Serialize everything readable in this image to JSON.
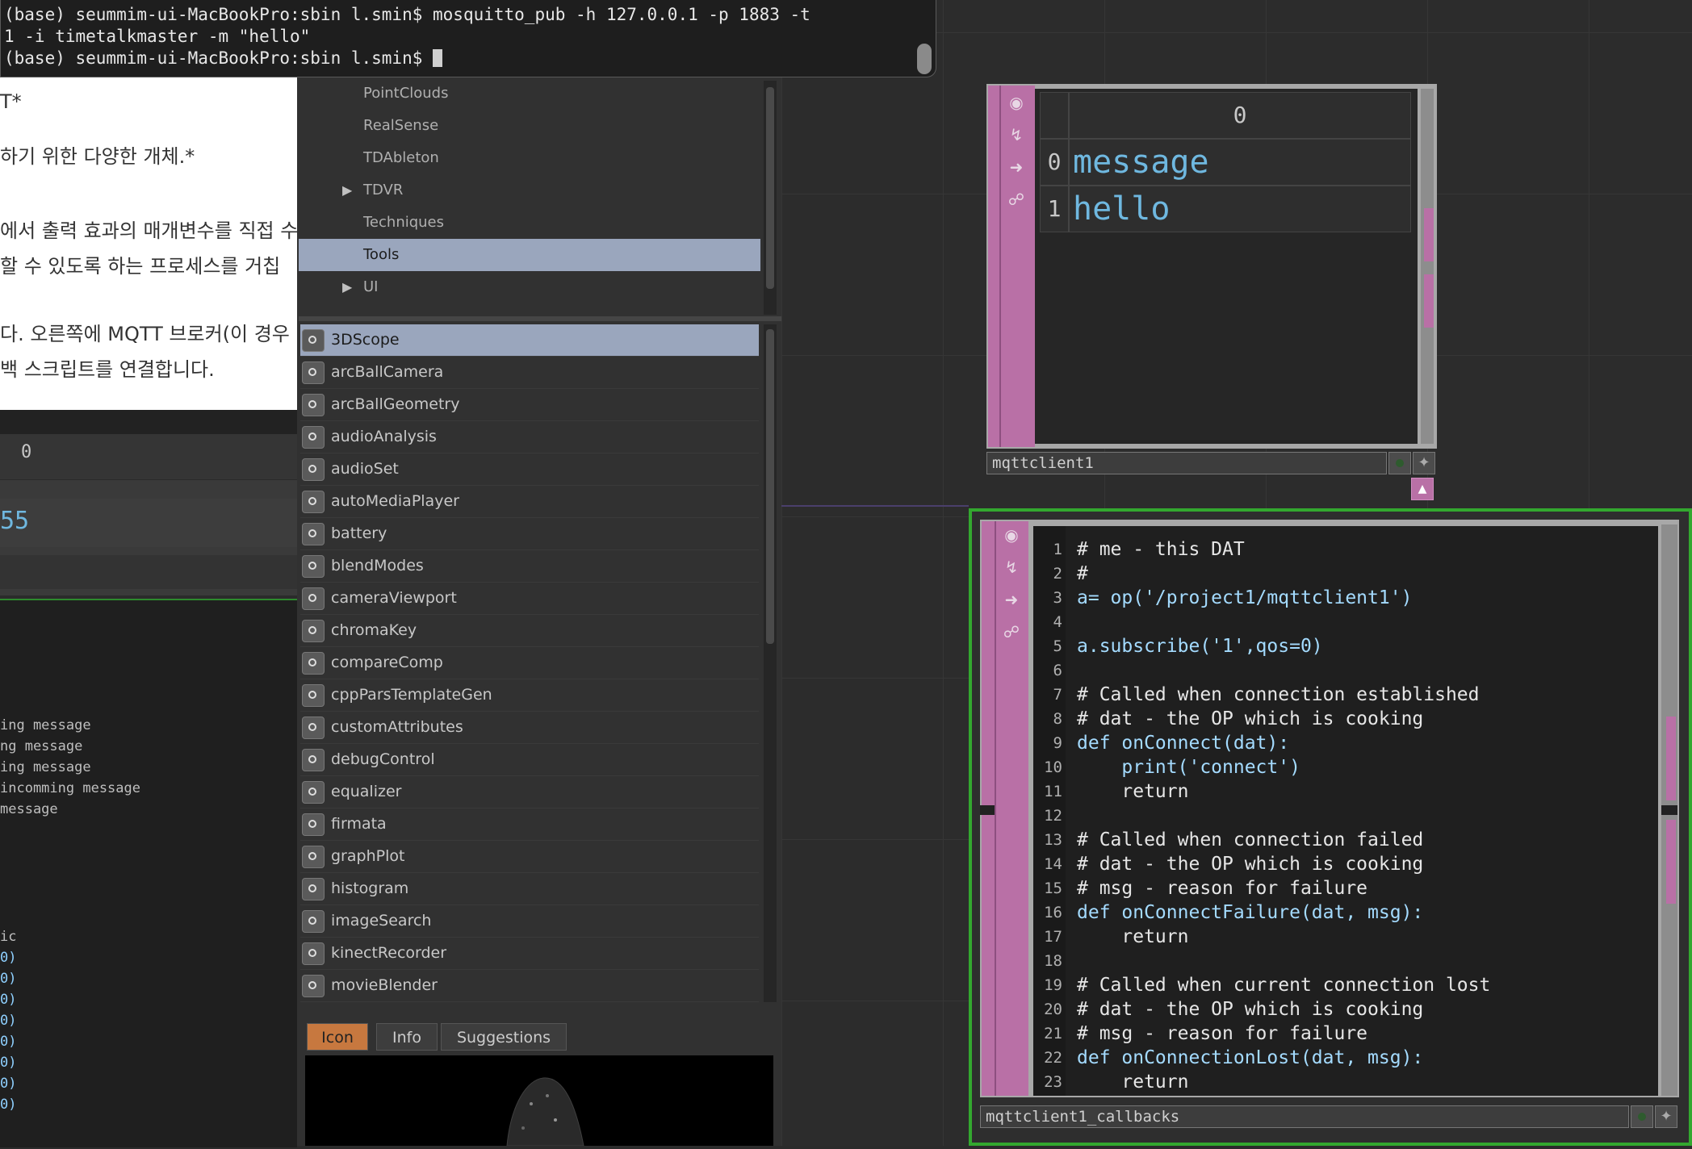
{
  "terminal": {
    "line1": "(base) seummim-ui-MacBookPro:sbin l.smin$ mosquitto_pub -h 127.0.0.1 -p 1883 -t ",
    "line2": "1 -i timetalkmaster -m \"hello\"",
    "line3": "(base) seummim-ui-MacBookPro:sbin l.smin$ "
  },
  "doc": {
    "lines": [
      "T*",
      "하기 위한 다양한 개체.*",
      "에서 출력 효과의 매개변수를 직접 수",
      "할 수 있도록 하는 프로세스를 거칩",
      "다. 오른쪽에 MQTT 브로커(이 경우",
      "백 스크립트를 연결합니다."
    ]
  },
  "left_panel": {
    "header_value": "0",
    "value": "55",
    "log_lines": [
      "ing message",
      "ng message",
      "ing message",
      "incomming message",
      "message"
    ],
    "topic_label": "ic",
    "topic_values": [
      "0)",
      "0)",
      "0)",
      "0)",
      "0)",
      "0)",
      "0)",
      "0)"
    ]
  },
  "palette": {
    "categories": [
      {
        "label": "PointClouds",
        "expandable": false,
        "selected": false
      },
      {
        "label": "RealSense",
        "expandable": false,
        "selected": false
      },
      {
        "label": "TDAbleton",
        "expandable": false,
        "selected": false
      },
      {
        "label": "TDVR",
        "expandable": true,
        "selected": false
      },
      {
        "label": "Techniques",
        "expandable": false,
        "selected": false
      },
      {
        "label": "Tools",
        "expandable": false,
        "selected": true
      },
      {
        "label": "UI",
        "expandable": true,
        "selected": false
      }
    ],
    "items": [
      "3DScope",
      "arcBallCamera",
      "arcBallGeometry",
      "audioAnalysis",
      "audioSet",
      "autoMediaPlayer",
      "battery",
      "blendModes",
      "cameraViewport",
      "chromaKey",
      "compareComp",
      "cppParsTemplateGen",
      "customAttributes",
      "debugControl",
      "equalizer",
      "firmata",
      "graphPlot",
      "histogram",
      "imageSearch",
      "kinectRecorder",
      "movieBlender"
    ],
    "selected_item": "3DScope",
    "tabs": [
      "Icon",
      "Info",
      "Suggestions"
    ],
    "active_tab": "Icon"
  },
  "mqtt_op": {
    "name": "mqttclient1",
    "column_header": "0",
    "rows": [
      {
        "index": "0",
        "value": "message"
      },
      {
        "index": "1",
        "value": "hello"
      }
    ]
  },
  "callbacks_op": {
    "name": "mqttclient1_callbacks",
    "code": [
      {
        "n": "1",
        "text": "# me - this DAT"
      },
      {
        "n": "2",
        "text": "#"
      },
      {
        "n": "3",
        "text": "a= op('/project1/mqttclient1')"
      },
      {
        "n": "4",
        "text": ""
      },
      {
        "n": "5",
        "text": "a.subscribe('1',qos=0)"
      },
      {
        "n": "6",
        "text": ""
      },
      {
        "n": "7",
        "text": "# Called when connection established"
      },
      {
        "n": "8",
        "text": "# dat - the OP which is cooking"
      },
      {
        "n": "9",
        "text": "def onConnect(dat):"
      },
      {
        "n": "10",
        "text": "    print('connect')"
      },
      {
        "n": "11",
        "text": "    return"
      },
      {
        "n": "12",
        "text": ""
      },
      {
        "n": "13",
        "text": "# Called when connection failed"
      },
      {
        "n": "14",
        "text": "# dat - the OP which is cooking"
      },
      {
        "n": "15",
        "text": "# msg - reason for failure"
      },
      {
        "n": "16",
        "text": "def onConnectFailure(dat, msg):"
      },
      {
        "n": "17",
        "text": "    return"
      },
      {
        "n": "18",
        "text": ""
      },
      {
        "n": "19",
        "text": "# Called when current connection lost"
      },
      {
        "n": "20",
        "text": "# dat - the OP which is cooking"
      },
      {
        "n": "21",
        "text": "# msg - reason for failure"
      },
      {
        "n": "22",
        "text": "def onConnectionLost(dat, msg):"
      },
      {
        "n": "23",
        "text": "    return"
      }
    ]
  },
  "colors": {
    "dat_accent": "#b970a6",
    "selection": "#9aa6bd",
    "active_tab": "#c7783f",
    "viewer_border": "#33a82f",
    "table_text": "#6fb8e0"
  }
}
